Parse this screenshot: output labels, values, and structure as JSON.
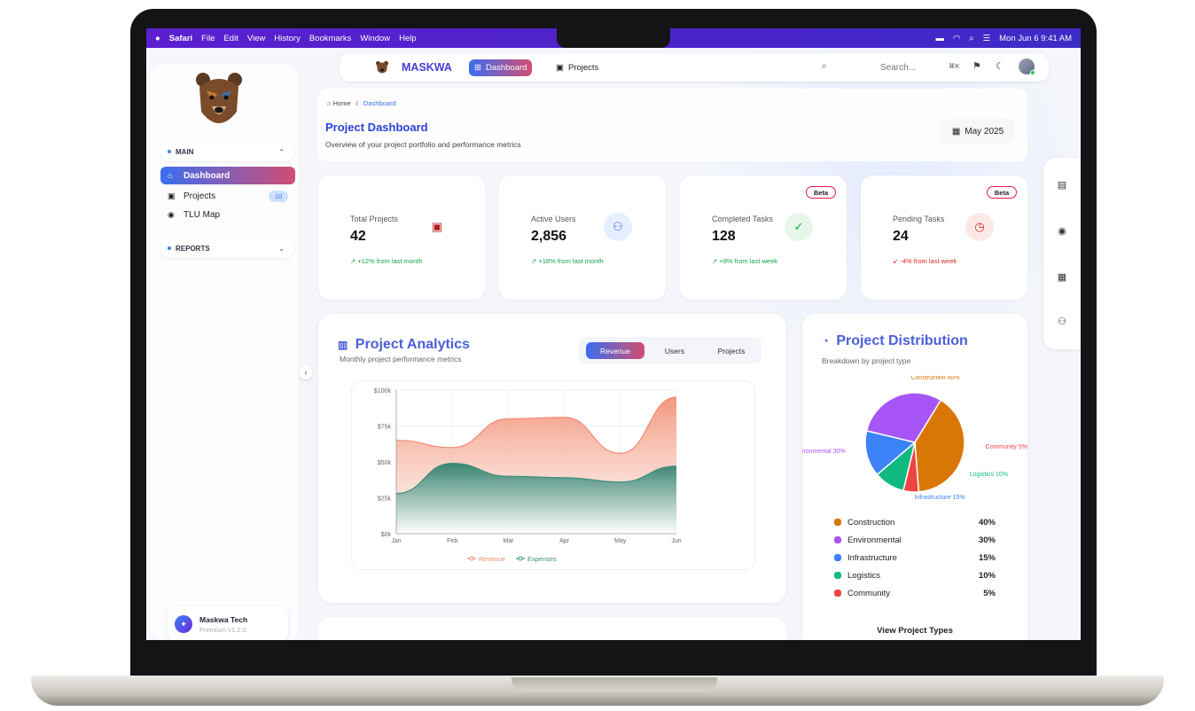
{
  "menubar": {
    "apple": "",
    "app": "Safari",
    "items": [
      "File",
      "Edit",
      "View",
      "History",
      "Bookmarks",
      "Window",
      "Help"
    ],
    "datetime": "Mon Jun 6  9:41 AM"
  },
  "sidebar": {
    "main_label": "MAIN",
    "items": [
      {
        "label": "Dashboard",
        "icon": "home-icon",
        "active": true
      },
      {
        "label": "Projects",
        "icon": "briefcase-icon",
        "badge": "10"
      },
      {
        "label": "TLU Map",
        "icon": "map-pin-icon"
      }
    ],
    "reports_label": "REPORTS",
    "company": {
      "name": "Maskwa Tech",
      "version": "Premium v1.2.0"
    }
  },
  "topnav": {
    "brand": "MASKWA",
    "tabs": [
      {
        "label": "Dashboard",
        "active": true
      },
      {
        "label": "Projects"
      }
    ],
    "search_placeholder": "Search...",
    "shortcut": "⌘K"
  },
  "header": {
    "breadcrumb_home": "Home",
    "breadcrumb_sep": "/",
    "breadcrumb_current": "Dashboard",
    "title": "Project Dashboard",
    "subtitle": "Overview of your project portfolio and performance metrics",
    "date": "May 2025"
  },
  "stats": [
    {
      "label": "Total Projects",
      "value": "42",
      "trend": "↗ +12% from last month",
      "icon": "briefcase-icon",
      "color": "#fde8e8"
    },
    {
      "label": "Active Users",
      "value": "2,856",
      "trend": "↗ +18% from last month",
      "icon": "users-icon",
      "color": "#e6efff"
    },
    {
      "label": "Completed Tasks",
      "value": "128",
      "trend": "↗ +8% from last week",
      "icon": "check-circle-icon",
      "color": "#e6f7ea",
      "badge": "Beta"
    },
    {
      "label": "Pending Tasks",
      "value": "24",
      "trend": "↙ -4% from last week",
      "icon": "clock-icon",
      "color": "#fde8e8",
      "badge": "Beta"
    }
  ],
  "analytics": {
    "title": "Project Analytics",
    "subtitle": "Monthly project performance metrics",
    "segments": [
      "Revenue",
      "Users",
      "Projects"
    ],
    "active_segment": "Revenue"
  },
  "chart_data": {
    "type": "area",
    "x": [
      "Jan",
      "Feb",
      "Mar",
      "Apr",
      "May",
      "Jun"
    ],
    "yticks": [
      "$0k",
      "$25k",
      "$50k",
      "$75k",
      "$100k"
    ],
    "ylim": [
      0,
      100
    ],
    "series": [
      {
        "name": "Revenue",
        "values": [
          65,
          60,
          80,
          81,
          56,
          95
        ],
        "color": "#f28b70"
      },
      {
        "name": "Expenses",
        "values": [
          28,
          49,
          40,
          39,
          36,
          47
        ],
        "color": "#3d8f7a"
      }
    ],
    "legend": "bottom"
  },
  "distribution": {
    "title": "Project Distribution",
    "subtitle": "Breakdown by project type",
    "slices": [
      {
        "name": "Construction",
        "value": 40,
        "pct": "40%",
        "color": "#d97706",
        "label": "Construction 40%"
      },
      {
        "name": "Community",
        "value": 5,
        "pct": "5%",
        "color": "#ef4444",
        "label": "Community 5%"
      },
      {
        "name": "Logistics",
        "value": 10,
        "pct": "10%",
        "color": "#10b981",
        "label": "Logistics 10%"
      },
      {
        "name": "Infrastructure",
        "value": 15,
        "pct": "15%",
        "color": "#3b82f6",
        "label": "Infrastructure 15%"
      },
      {
        "name": "Environmental",
        "value": 30,
        "pct": "30%",
        "color": "#a855f7",
        "label": "ironmental 30%"
      }
    ],
    "view_button": "View Project Types"
  }
}
